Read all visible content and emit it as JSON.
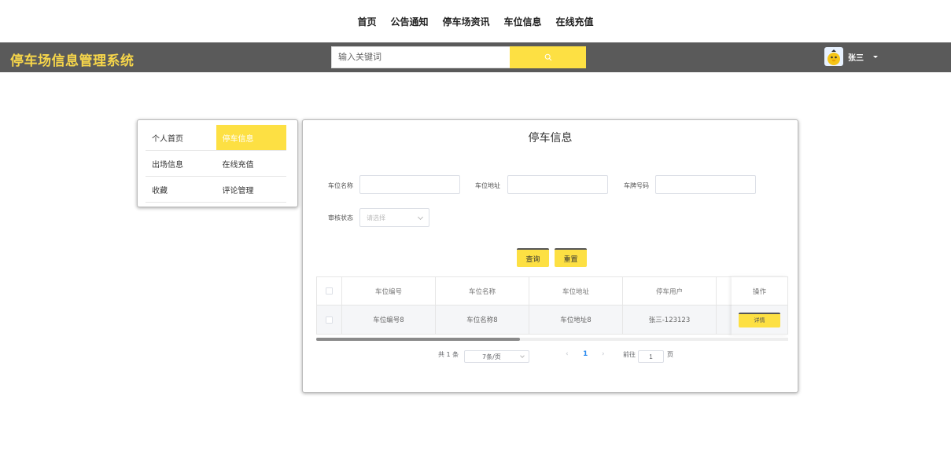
{
  "topnav": {
    "items": [
      "首页",
      "公告通知",
      "停车场资讯",
      "车位信息",
      "在线充值"
    ]
  },
  "header": {
    "brand": "停车场信息管理系统",
    "search_placeholder": "输入关键词",
    "search_icon": "search-icon",
    "username": "张三",
    "colors": {
      "bar": "#5a5a5a",
      "brand": "#f7d64a",
      "accent": "#fde043"
    }
  },
  "sidemenu": {
    "rows": [
      [
        "个人首页",
        "停车信息"
      ],
      [
        "出场信息",
        "在线充值"
      ],
      [
        "收藏",
        "评论管理"
      ]
    ],
    "active": "停车信息"
  },
  "panel": {
    "title": "停车信息",
    "filters": {
      "slot_name_label": "车位名称",
      "slot_address_label": "车位地址",
      "plate_label": "车牌号码",
      "audit_label": "审核状态",
      "audit_placeholder": "请选择"
    },
    "buttons": {
      "query": "查询",
      "reset": "重置"
    },
    "table": {
      "headers": [
        "车位编号",
        "车位名称",
        "车位地址",
        "停车用户"
      ],
      "op_header": "操作",
      "rows": [
        {
          "cells": [
            "车位编号8",
            "车位名称8",
            "车位地址8",
            "张三-123123"
          ],
          "action": "详情"
        }
      ]
    },
    "pagination": {
      "total": "共 1 条",
      "page_size": "7条/页",
      "prev": "‹",
      "current_page": "1",
      "next": "›",
      "goto_label": "前往",
      "goto_value": "1",
      "page_suffix": "页"
    }
  }
}
